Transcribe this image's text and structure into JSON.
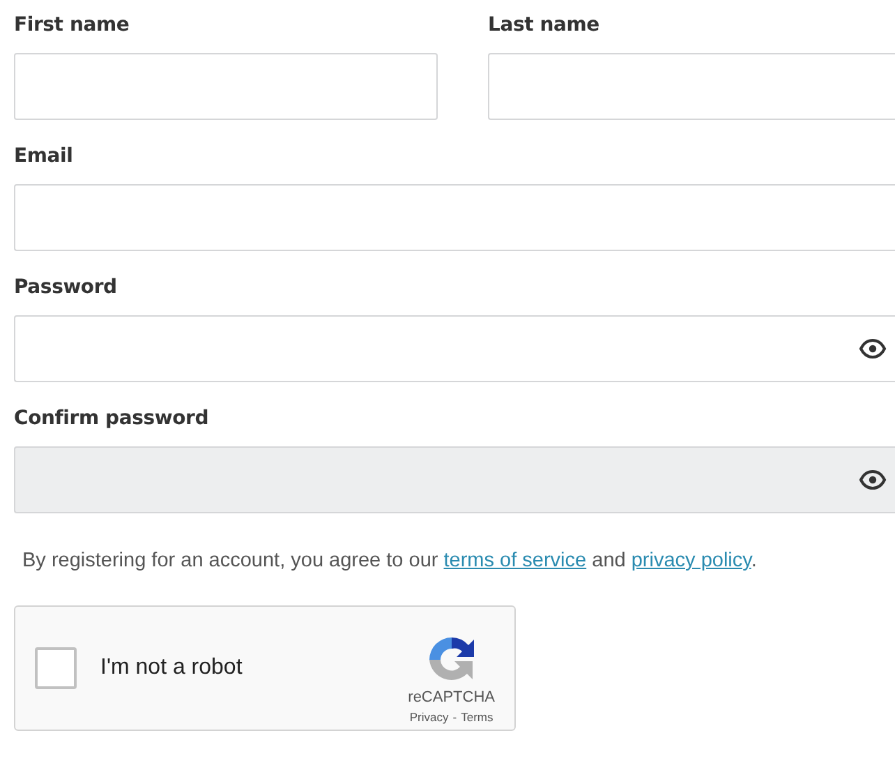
{
  "rows": [
    [
      {
        "label": "First name",
        "kind": "text",
        "disabled": false
      },
      {
        "label": "Last name",
        "kind": "text",
        "disabled": false
      }
    ],
    [
      {
        "label": "Email",
        "kind": "text",
        "disabled": false
      }
    ],
    [
      {
        "label": "Password",
        "kind": "password",
        "disabled": false
      }
    ],
    [
      {
        "label": "Confirm password",
        "kind": "password",
        "disabled": true
      }
    ]
  ],
  "agreement": [
    {
      "kind": "text",
      "text": "By registering for an account, you agree to our "
    },
    {
      "kind": "link",
      "text": "terms of service"
    },
    {
      "kind": "text",
      "text": " and "
    },
    {
      "kind": "link",
      "text": "privacy policy"
    },
    {
      "kind": "text",
      "text": "."
    }
  ],
  "captcha": {
    "label": "I'm not a robot",
    "checked": false,
    "brand": "reCAPTCHA",
    "links": [
      "Privacy",
      "Terms"
    ],
    "separator": "-"
  }
}
